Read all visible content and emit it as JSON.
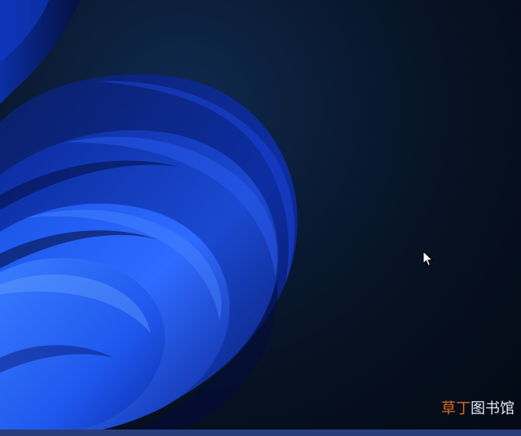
{
  "desktop": {
    "wallpaper_icon": "windows-11-bloom-wallpaper",
    "colors": {
      "background_dark": "#06101f",
      "bloom_primary": "#1f52e0",
      "bloom_dark": "#071a6d",
      "bloom_highlight": "#4a86ff",
      "taskbar_edge": "#2a3d7a"
    }
  },
  "cursor": {
    "icon": "mouse-pointer-icon"
  },
  "watermark": {
    "part1": "草丁",
    "part2": "图书馆",
    "part1_color": "#d96b1a",
    "part2_color": "#e5e8ee"
  }
}
